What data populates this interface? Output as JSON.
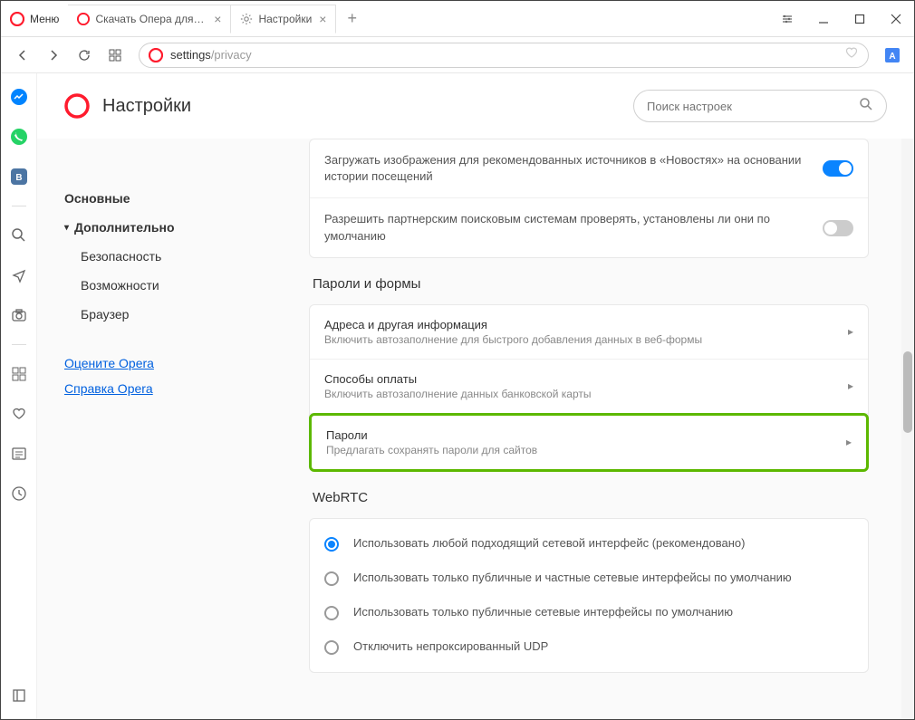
{
  "menu_label": "Меню",
  "tabs": [
    {
      "title": "Скачать Опера для компь",
      "active": false
    },
    {
      "title": "Настройки",
      "active": true
    }
  ],
  "address": {
    "prefix": "settings",
    "suffix": "/privacy"
  },
  "header": {
    "title": "Настройки",
    "search_placeholder": "Поиск настроек"
  },
  "sidebar": {
    "basic": "Основные",
    "advanced": "Дополнительно",
    "security": "Безопасность",
    "features": "Возможности",
    "browser": "Браузер",
    "rate": "Оцените Opera",
    "help": "Справка Opera"
  },
  "top_card": {
    "row1": "Загружать изображения для рекомендованных источников в «Новостях» на основании истории посещений",
    "row2": "Разрешить партнерским поисковым системам проверять, установлены ли они по умолчанию"
  },
  "passwords_forms": {
    "title": "Пароли и формы",
    "addresses": {
      "title": "Адреса и другая информация",
      "desc": "Включить автозаполнение для быстрого добавления данных в веб-формы"
    },
    "payment": {
      "title": "Способы оплаты",
      "desc": "Включить автозаполнение данных банковской карты"
    },
    "passwords": {
      "title": "Пароли",
      "desc": "Предлагать сохранять пароли для сайтов"
    }
  },
  "webrtc": {
    "title": "WebRTC",
    "options": [
      "Использовать любой подходящий сетевой интерфейс (рекомендовано)",
      "Использовать только публичные и частные сетевые интерфейсы по умолчанию",
      "Использовать только публичные сетевые интерфейсы по умолчанию",
      "Отключить непроксированный UDP"
    ]
  }
}
